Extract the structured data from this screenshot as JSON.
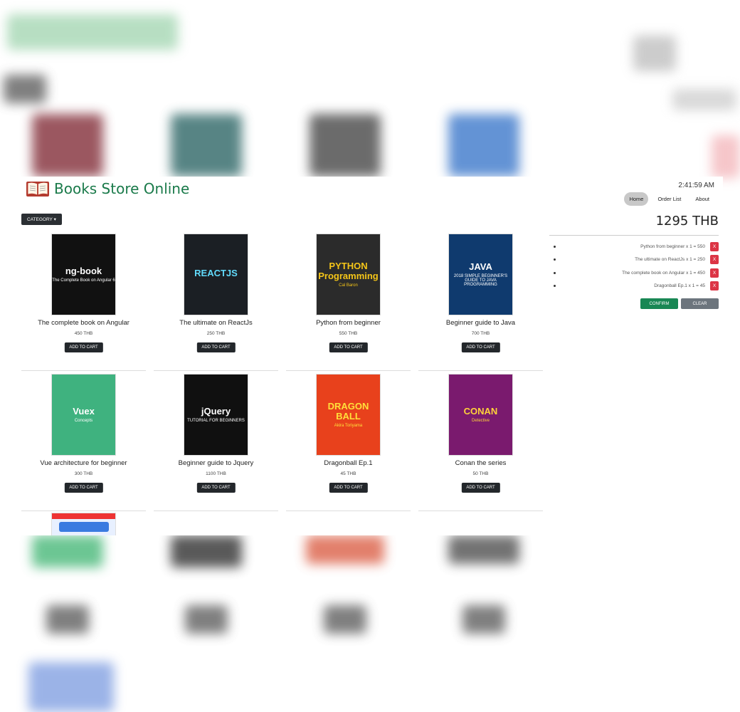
{
  "app": {
    "title": "Books Store Online",
    "clock": "2:41:59 AM"
  },
  "nav": {
    "items": [
      {
        "label": "Home",
        "active": true
      },
      {
        "label": "Order List",
        "active": false
      },
      {
        "label": "About",
        "active": false
      }
    ]
  },
  "category": {
    "label": "CATEGORY ▾"
  },
  "books": [
    {
      "title": "The complete book on Angular",
      "price": "450 THB",
      "cover_text": "ng-book",
      "cover_sub": "The Complete Book on Angular 6",
      "cover_bg": "#111111",
      "cover_fg": "#ffffff"
    },
    {
      "title": "The ultimate on ReactJs",
      "price": "250 THB",
      "cover_text": "REACTJS",
      "cover_sub": "",
      "cover_bg": "#1b1f24",
      "cover_fg": "#61dafb"
    },
    {
      "title": "Python from beginner",
      "price": "550 THB",
      "cover_text": "PYTHON Programming",
      "cover_sub": "Cal Baron",
      "cover_bg": "#2b2b2b",
      "cover_fg": "#f5c518"
    },
    {
      "title": "Beginner guide to Java",
      "price": "700 THB",
      "cover_text": "JAVA",
      "cover_sub": "2018 SIMPLE BEGINNER'S GUIDE TO JAVA PROGRAMMING",
      "cover_bg": "#0f3a6e",
      "cover_fg": "#ffffff"
    },
    {
      "title": "Vue architecture for beginner",
      "price": "300 THB",
      "cover_text": "Vuex",
      "cover_sub": "Concepts",
      "cover_bg": "#3fb27f",
      "cover_fg": "#ffffff"
    },
    {
      "title": "Beginner guide to Jquery",
      "price": "1100 THB",
      "cover_text": "jQuery",
      "cover_sub": "TUTORIAL FOR BEGINNERS",
      "cover_bg": "#101010",
      "cover_fg": "#ffffff"
    },
    {
      "title": "Dragonball Ep.1",
      "price": "45 THB",
      "cover_text": "DRAGON BALL",
      "cover_sub": "Akira Toriyama",
      "cover_bg": "#e8411c",
      "cover_fg": "#ffe03a"
    },
    {
      "title": "Conan the series",
      "price": "50 THB",
      "cover_text": "CONAN",
      "cover_sub": "Detective",
      "cover_bg": "#7a1a6e",
      "cover_fg": "#ffd23a"
    }
  ],
  "add_label": "ADD TO CART",
  "cart": {
    "total": "1295 THB",
    "items": [
      {
        "text": "Python from beginner x 1 = 550"
      },
      {
        "text": "The ultimate on ReactJs x 1 = 250"
      },
      {
        "text": "The complete book on Angular x 1 = 450"
      },
      {
        "text": "Dragonball Ep.1 x 1 = 45"
      }
    ],
    "remove_label": "X",
    "confirm_label": "CONFIRM",
    "clear_label": "CLEAR"
  },
  "colors": {
    "brand": "#1a7a4a",
    "confirm": "#198754",
    "remove": "#dc3545",
    "clear": "#6c757d"
  }
}
